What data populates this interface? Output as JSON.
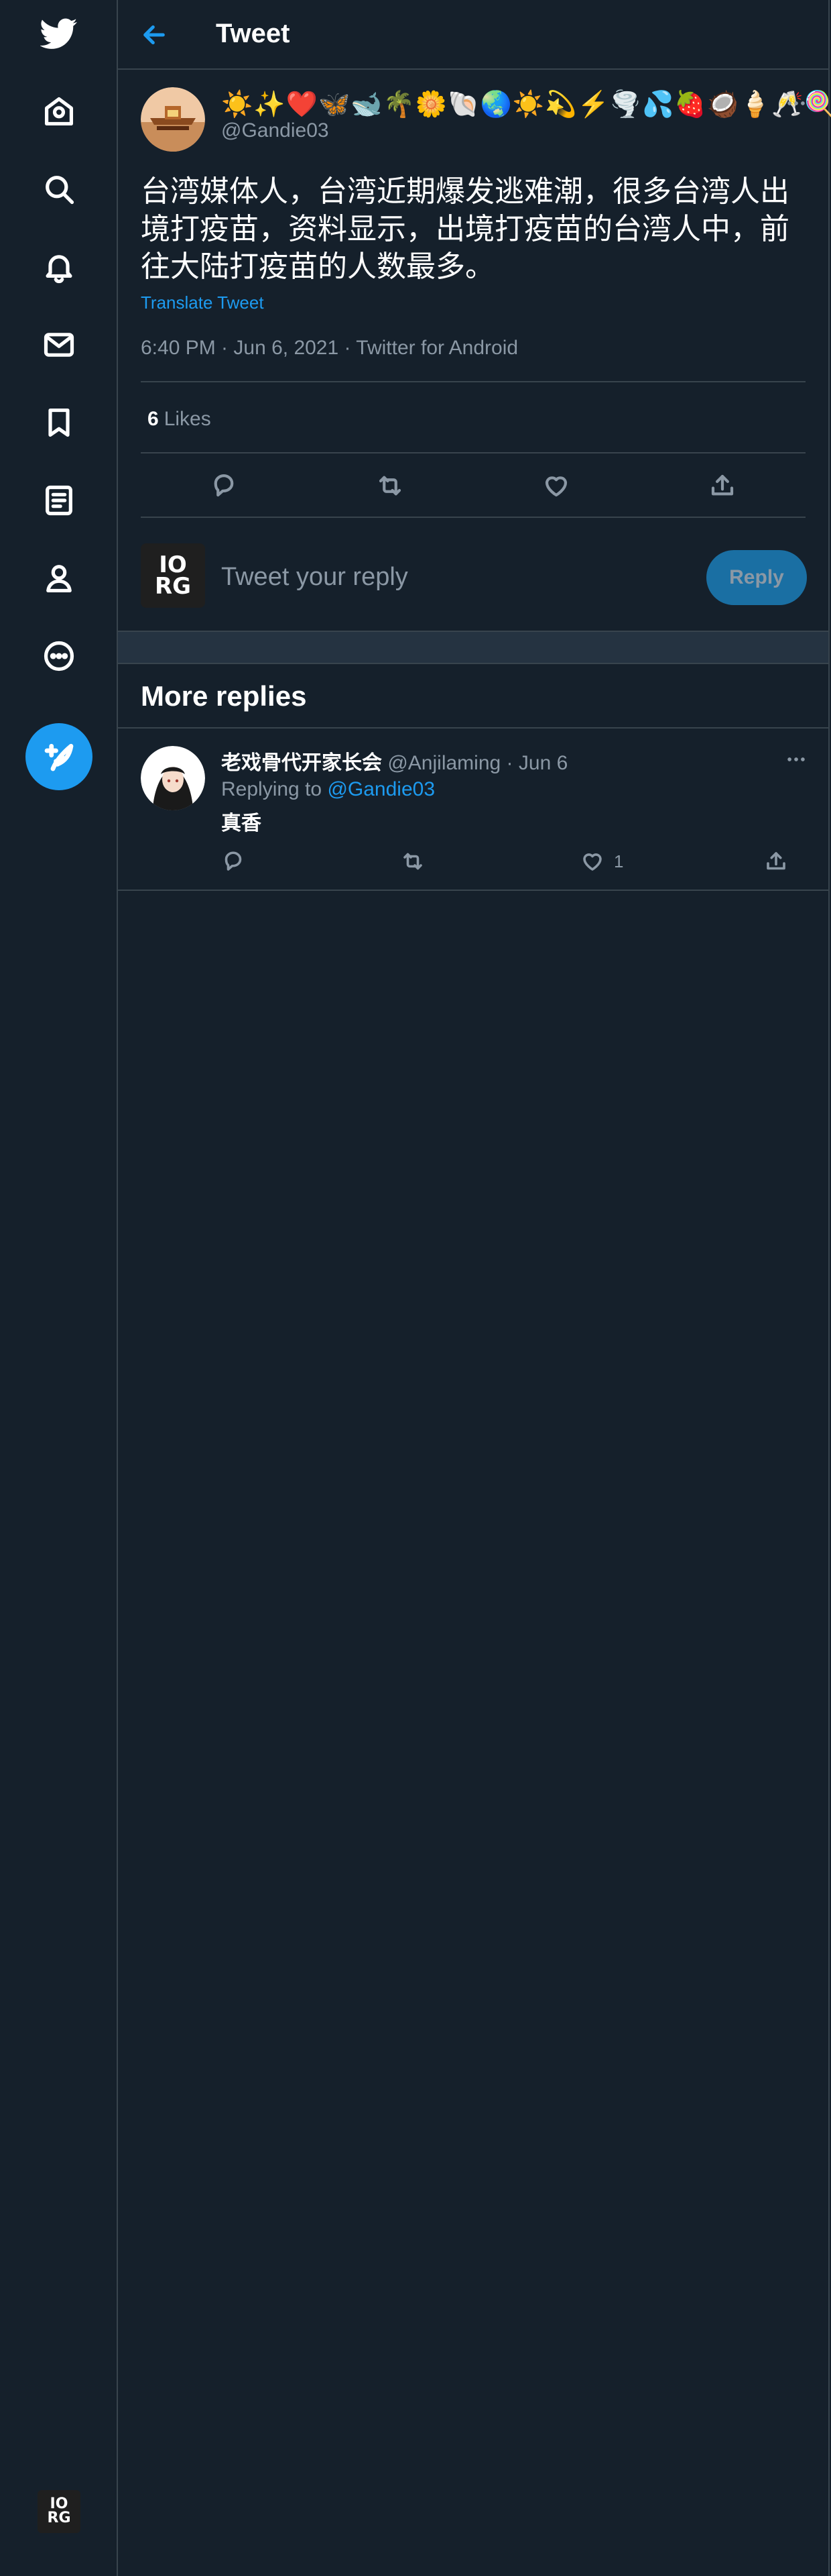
{
  "sidebar": {
    "logo_icon": "twitter-bird-icon",
    "nav": [
      {
        "name": "home",
        "icon": "home-icon"
      },
      {
        "name": "explore",
        "icon": "search-icon"
      },
      {
        "name": "notifications",
        "icon": "bell-icon"
      },
      {
        "name": "messages",
        "icon": "mail-icon"
      },
      {
        "name": "bookmarks",
        "icon": "bookmark-icon"
      },
      {
        "name": "lists",
        "icon": "list-icon"
      },
      {
        "name": "profile",
        "icon": "person-icon"
      },
      {
        "name": "more",
        "icon": "more-circle-icon"
      }
    ],
    "compose_icon": "feather-plus-icon",
    "account_avatar": {
      "top": "IO",
      "bottom": "RG"
    }
  },
  "header": {
    "title": "Tweet",
    "back_icon": "arrow-left-icon"
  },
  "tweet": {
    "author_name": "☀️✨❤️🦋🐋🌴🌼🐚🌏☀️💫⚡️🌪️💦🍓🥥🍦🥂🍭",
    "author_handle": "@Gandie03",
    "text": "台湾媒体人，台湾近期爆发逃难潮，很多台湾人出境打疫苗，资料显示，出境打疫苗的台湾人中，前往大陆打疫苗的人数最多。",
    "translate_label": "Translate Tweet",
    "meta": "6:40 PM · Jun 6, 2021 · Twitter for Android",
    "likes_count": "6",
    "likes_label": "Likes"
  },
  "reply_box": {
    "avatar": {
      "top": "IO",
      "bottom": "RG"
    },
    "placeholder": "Tweet your reply",
    "button_label": "Reply"
  },
  "more_replies": {
    "title": "More replies",
    "items": [
      {
        "name": "老戏骨代开家长会",
        "handle": "@Anjilaming",
        "separator": "·",
        "date": "Jun 6",
        "replying_label": "Replying to",
        "replying_handle": "@Gandie03",
        "text": "真香",
        "like_count": "1"
      }
    ]
  },
  "colors": {
    "background": "#15202b",
    "border": "#38444d",
    "accent": "#1d9bf0",
    "secondary_text": "#8b98a5"
  }
}
